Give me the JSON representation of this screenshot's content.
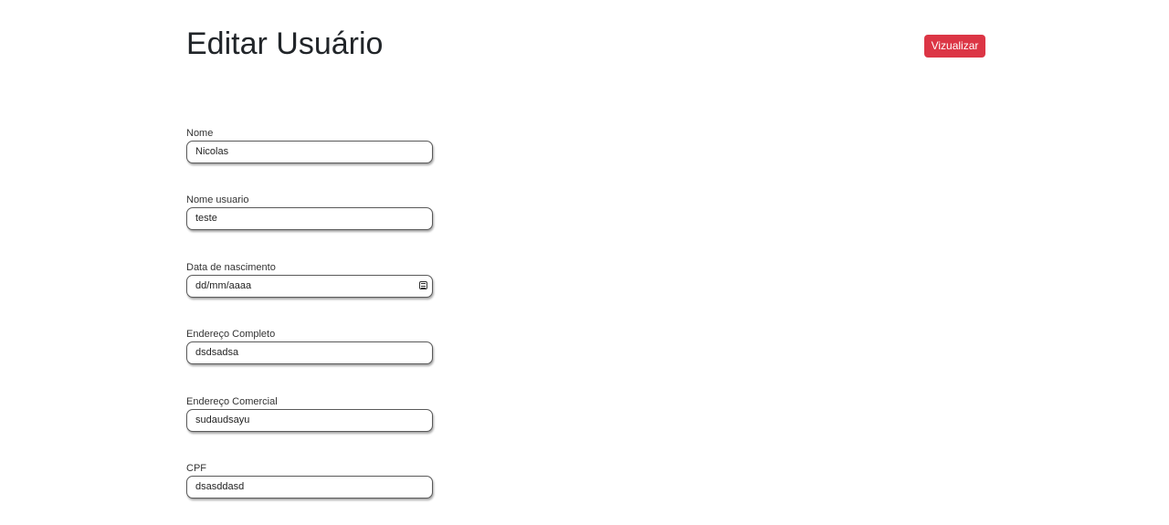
{
  "header": {
    "title": "Editar Usuário",
    "view_button_label": "Vizualizar"
  },
  "colors": {
    "view_button_bg": "#dc3545",
    "text": "#212529"
  },
  "form": {
    "fields": [
      {
        "label": "Nome",
        "value": "Nicolas"
      },
      {
        "label": "Nome usuario",
        "value": "teste"
      },
      {
        "label": "Data de nascimento",
        "value": "dd/mm/aaaa",
        "icon": "calendar-icon"
      },
      {
        "label": "Endereço Completo",
        "value": "dsdsadsa"
      },
      {
        "label": "Endereço Comercial",
        "value": "sudaudsayu"
      },
      {
        "label": "CPF",
        "value": "dsasddasd"
      }
    ]
  }
}
